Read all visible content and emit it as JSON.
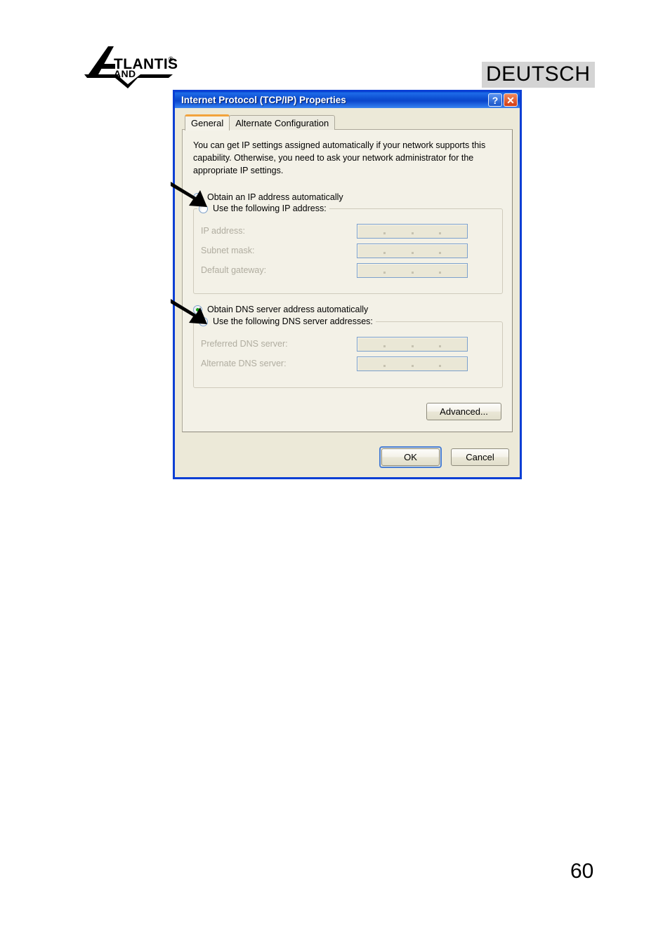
{
  "page": {
    "language_badge": "DEUTSCH",
    "page_number": "60",
    "logo_text_primary": "ATLANTIS",
    "logo_text_secondary": "LAND",
    "logo_registered_mark": "®"
  },
  "dialog": {
    "title": "Internet Protocol (TCP/IP) Properties",
    "titlebar_buttons": [
      {
        "name": "help-button",
        "glyph": "?"
      },
      {
        "name": "close-button",
        "glyph": "✕"
      }
    ],
    "tabs": [
      {
        "label": "General",
        "active": true
      },
      {
        "label": "Alternate Configuration",
        "active": false
      }
    ],
    "intro_text": "You can get IP settings assigned automatically if your network supports this capability. Otherwise, you need to ask your network administrator for the appropriate IP settings.",
    "ip_section": {
      "auto_option": {
        "label": "Obtain an IP address automatically",
        "selected": true
      },
      "manual_option": {
        "label": "Use the following IP address:",
        "selected": false
      },
      "fields": [
        {
          "label": "IP address:",
          "value": "",
          "enabled": false
        },
        {
          "label": "Subnet mask:",
          "value": "",
          "enabled": false
        },
        {
          "label": "Default gateway:",
          "value": "",
          "enabled": false
        }
      ]
    },
    "dns_section": {
      "auto_option": {
        "label": "Obtain DNS server address automatically",
        "selected": true
      },
      "manual_option": {
        "label": "Use the following DNS server addresses:",
        "selected": false
      },
      "fields": [
        {
          "label": "Preferred DNS server:",
          "value": "",
          "enabled": false
        },
        {
          "label": "Alternate DNS server:",
          "value": "",
          "enabled": false
        }
      ]
    },
    "advanced_button": "Advanced...",
    "ok_button": "OK",
    "cancel_button": "Cancel"
  },
  "annotations": {
    "arrows": [
      {
        "name": "arrow-pointing-to-obtain-ip-automatically"
      },
      {
        "name": "arrow-pointing-to-obtain-dns-automatically"
      }
    ]
  },
  "colors": {
    "titlebar_blue": "#0b45cc",
    "dialog_face": "#ece9d8",
    "panel_face": "#f3f1e7",
    "tab_active_accent": "#f2a33c",
    "radio_selected_green": "#17a014",
    "close_button_red": "#d23c14",
    "default_button_ring": "#4a7fd4",
    "badge_background": "#d4d4d4"
  }
}
